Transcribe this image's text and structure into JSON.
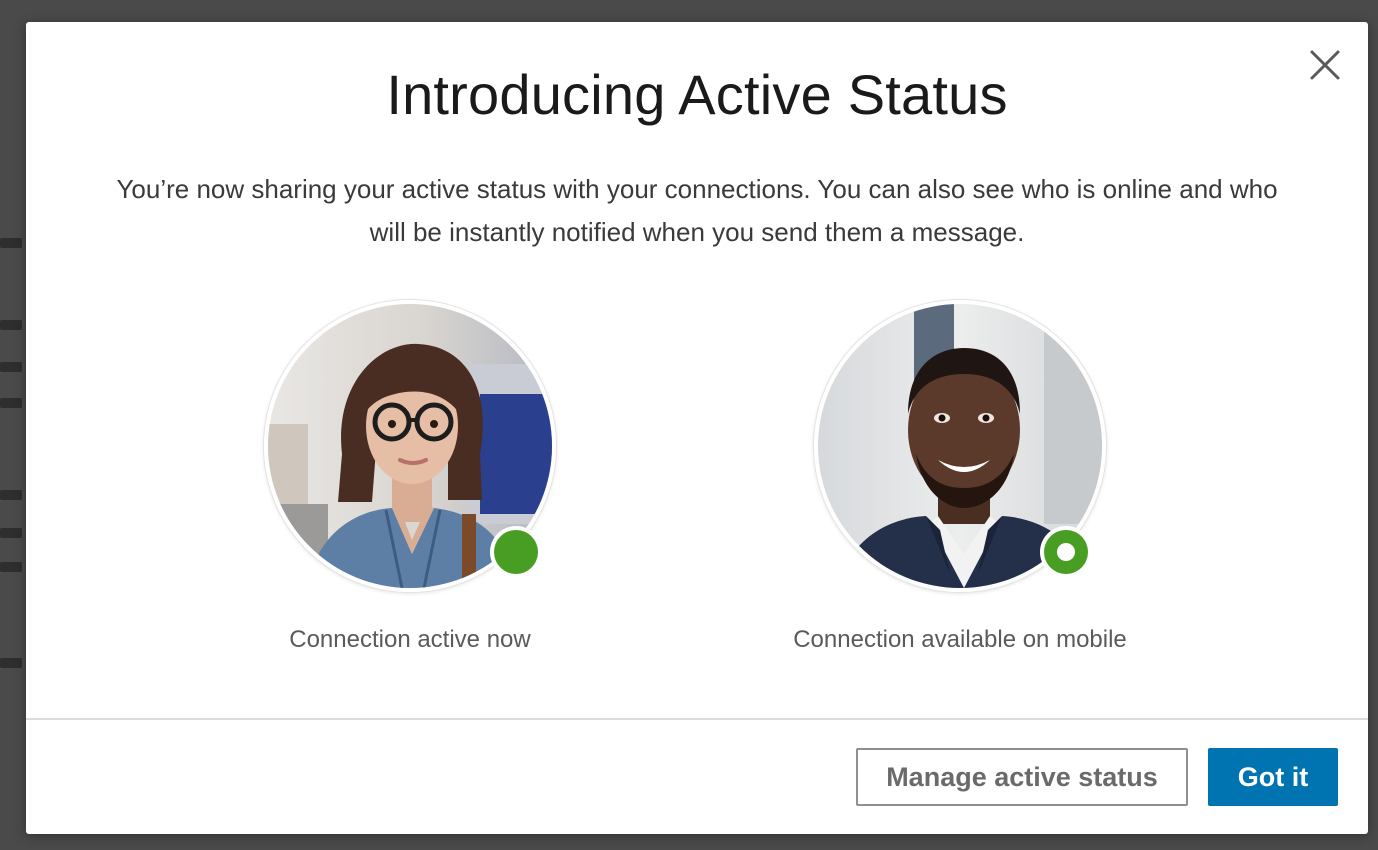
{
  "modal": {
    "title": "Introducing Active Status",
    "description": "You’re now sharing your active status with your connections. You can also see who is online and who will be instantly notified when you send them a message.",
    "close_icon": "close-icon",
    "personas": [
      {
        "caption": "Connection active now",
        "status": "active",
        "status_color": "#479e22"
      },
      {
        "caption": "Connection available on mobile",
        "status": "mobile",
        "status_color": "#479e22"
      }
    ],
    "buttons": {
      "secondary_label": "Manage active status",
      "primary_label": "Got it",
      "primary_color": "#0073b1"
    }
  }
}
